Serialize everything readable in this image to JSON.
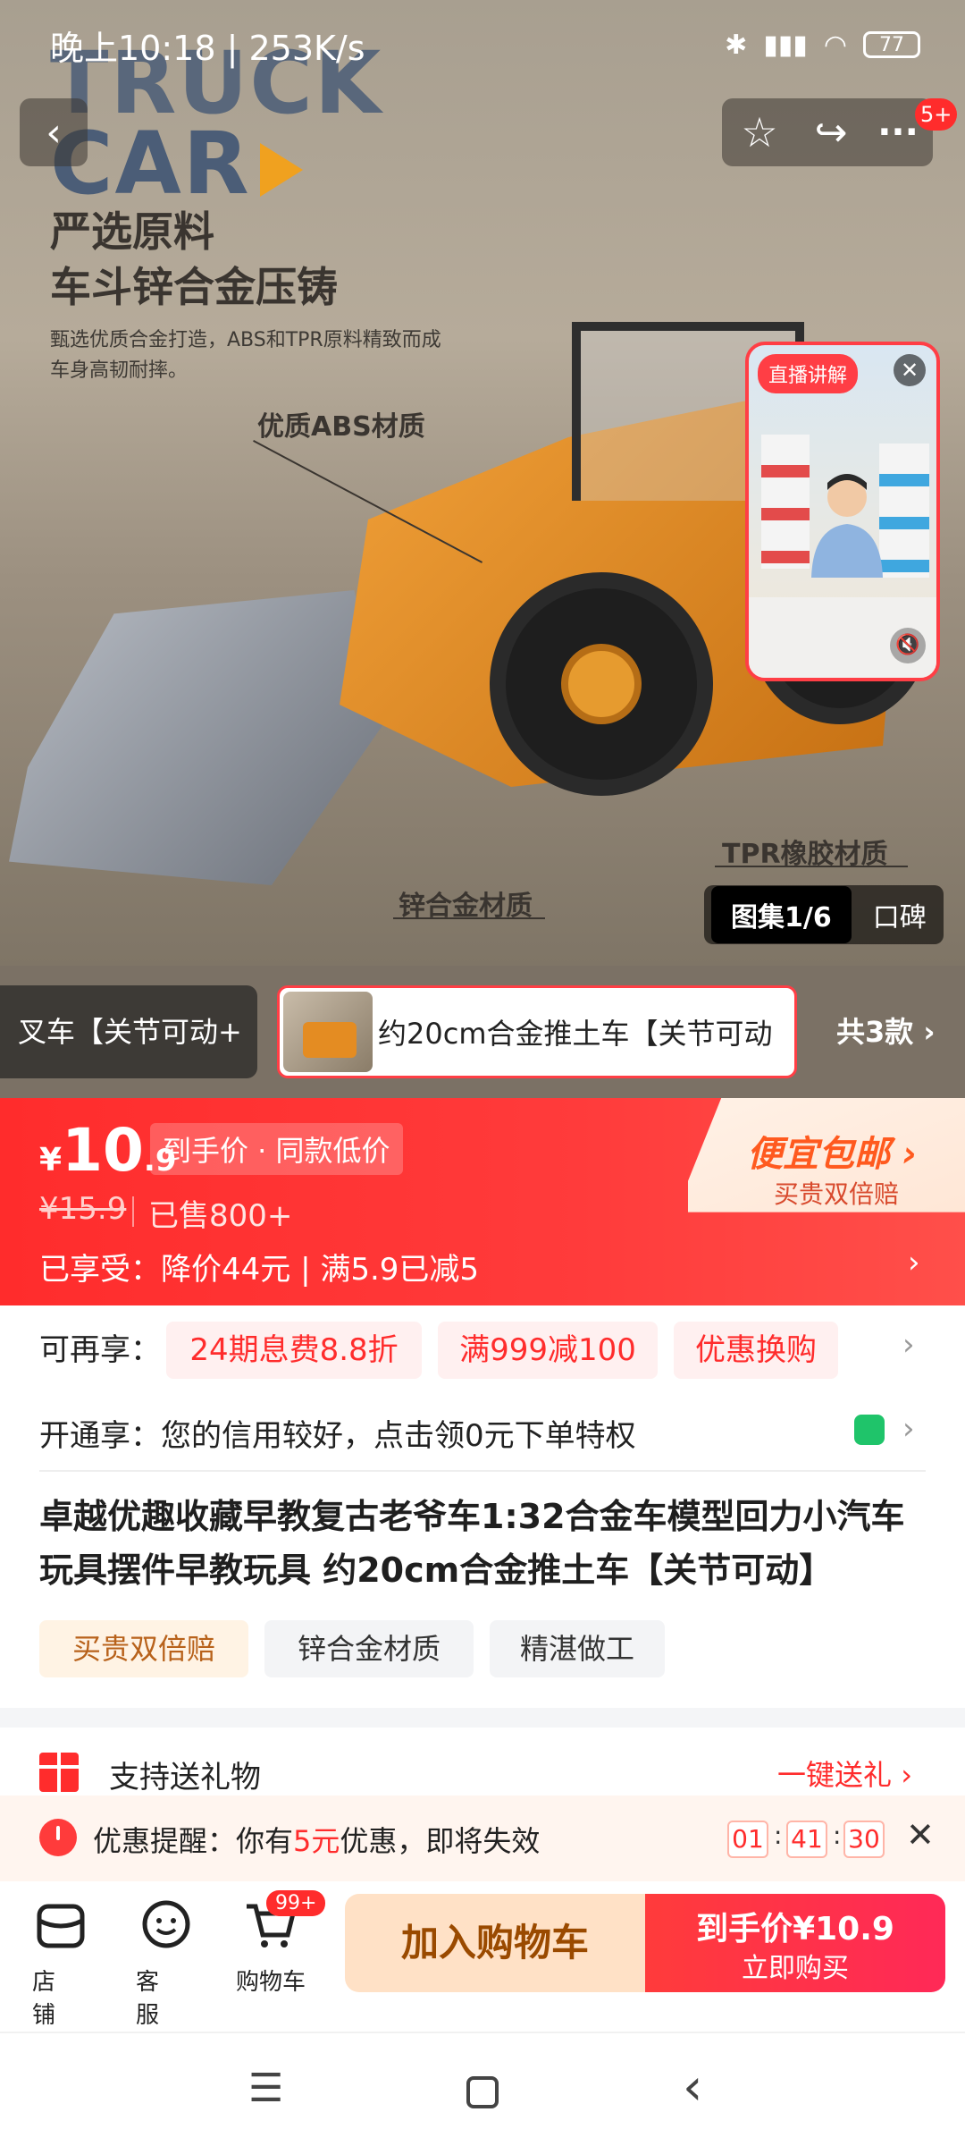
{
  "status_bar": {
    "time_speed": "晚上10:18 | 253K/s",
    "battery": "77"
  },
  "hero": {
    "brand_top": "TRUCK",
    "brand_bottom": "CAR",
    "headline_1": "严选原料",
    "headline_2": "车斗锌合金压铸",
    "subtext_1": "甄选优质合金打造，ABS和TPR原料精致而成",
    "subtext_2": "车身高韧耐摔。",
    "callout_abs": "优质ABS材质",
    "callout_tpr": "TPR橡胶材质",
    "callout_zinc": "锌合金材质",
    "gallery_tab": "图集1/6",
    "reviews_tab": "口碑",
    "badge_count": "5+"
  },
  "live": {
    "badge": "直播讲解",
    "caption": "..."
  },
  "variants": {
    "prev": "叉车【关节可动+",
    "current": "约20cm合金推土车【关节可动",
    "more": "共3款"
  },
  "price": {
    "symbol": "¥",
    "integer": "10",
    "decimal": ".9",
    "tag": "到手价 · 同款低价",
    "original": "¥15.9",
    "sold": "已售800+",
    "enjoyed": "已享受：降价44元 | 满5.9已减5",
    "shipping": "便宜包邮",
    "shipping_sub": "买贵双倍赔"
  },
  "promos": {
    "label": "可再享：",
    "chips": [
      "24期息费8.8折",
      "满999减100",
      "优惠换购"
    ],
    "open_label": "开通享：",
    "open_text": "您的信用较好，点击领0元下单特权"
  },
  "product": {
    "title": "卓越优趣收藏早教复古老爷车1:32合金车模型回力小汽车玩具摆件早教玩具 约20cm合金推土车【关节可动】",
    "tags": [
      "买贵双倍赔",
      "锌合金材质",
      "精湛做工"
    ]
  },
  "gift": {
    "label": "支持送礼物",
    "action": "一键送礼"
  },
  "reminder": {
    "prefix": "优惠提醒：你有",
    "amount": "5元",
    "suffix": "优惠，即将失效",
    "h": "01",
    "m": "41",
    "s": "30"
  },
  "bottom_bar": {
    "shop": "店铺",
    "service": "客服",
    "cart": "购物车",
    "cart_badge": "99+",
    "add_cart": "加入购物车",
    "buy_top": "到手价¥10.9",
    "buy_bottom": "立即购买"
  },
  "colors": {
    "accent": "#ff2c2c",
    "brand_orange": "#f0a11f"
  }
}
